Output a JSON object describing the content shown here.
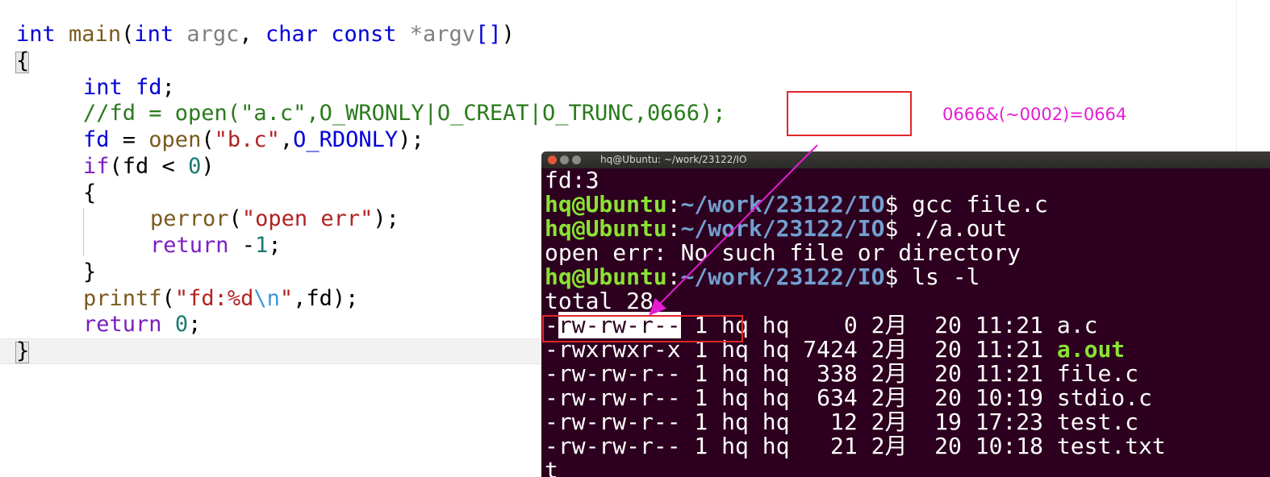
{
  "editor": {
    "lines": [
      [
        "int",
        "main",
        "(",
        "int",
        "argc",
        ", ",
        "char",
        "const",
        "*argv",
        "[]",
        ")"
      ],
      [
        "{"
      ],
      [
        "int",
        "fd",
        ";"
      ],
      [
        "//fd = open(\"a.c\",O_WRONLY|O_CREAT|O_TRUNC,0666);"
      ],
      [
        "fd",
        " = ",
        "open",
        "(",
        "\"b.c\"",
        ",",
        "O_RDONLY",
        ");"
      ],
      [
        "if",
        "(fd < ",
        "0",
        ")"
      ],
      [
        "{"
      ],
      [
        "perror",
        "(",
        "\"open err\"",
        ");"
      ],
      [
        "return",
        " -",
        "1",
        ";"
      ],
      [
        "}"
      ],
      [
        "printf",
        "(",
        "\"fd:%d",
        "\\n",
        "\"",
        ",fd);"
      ],
      [
        "return",
        " ",
        "0",
        ";"
      ],
      [
        "}"
      ]
    ]
  },
  "annotation": {
    "note": "0666&(~0002)=0664"
  },
  "terminal": {
    "title": "hq@Ubuntu: ~/work/23122/IO",
    "output1": "fd:3",
    "prompt_user": "hq@Ubuntu",
    "prompt_colon": ":",
    "prompt_path": "~/work/23122/IO",
    "prompt_dollar": "$",
    "cmd1": " gcc file.c",
    "cmd2": " ./a.out",
    "output2": "open err: No such file or directory",
    "cmd3": " ls -l",
    "output3": "total 28",
    "listing": [
      {
        "dash": "-",
        "perms": "rw-rw-r--",
        "rest": " 1 hq hq    0 2月  20 11:21 ",
        "name": "a.c"
      },
      {
        "dash": "",
        "perms": "-rwxrwxr-x",
        "rest": " 1 hq hq 7424 2月  20 11:21 ",
        "name": "a.out"
      },
      {
        "dash": "",
        "perms": "-rw-rw-r--",
        "rest": " 1 hq hq  338 2月  20 11:21 ",
        "name": "file.c"
      },
      {
        "dash": "",
        "perms": "-rw-rw-r--",
        "rest": " 1 hq hq  634 2月  20 10:19 ",
        "name": "stdio.c"
      },
      {
        "dash": "",
        "perms": "-rw-rw-r--",
        "rest": " 1 hq hq   12 2月  19 17:23 ",
        "name": "test.c"
      },
      {
        "dash": "",
        "perms": "-rw-rw-r--",
        "rest": " 1 hq hq   21 2月  20 10:18 ",
        "name": "test.txt"
      }
    ],
    "last_line": "t"
  },
  "colors": {
    "accent_red": "#e3262c",
    "arrow_magenta": "#e61cd4",
    "terminal_bg": "#2c001e",
    "prompt_green": "#8ae234",
    "path_blue": "#729fcf"
  }
}
